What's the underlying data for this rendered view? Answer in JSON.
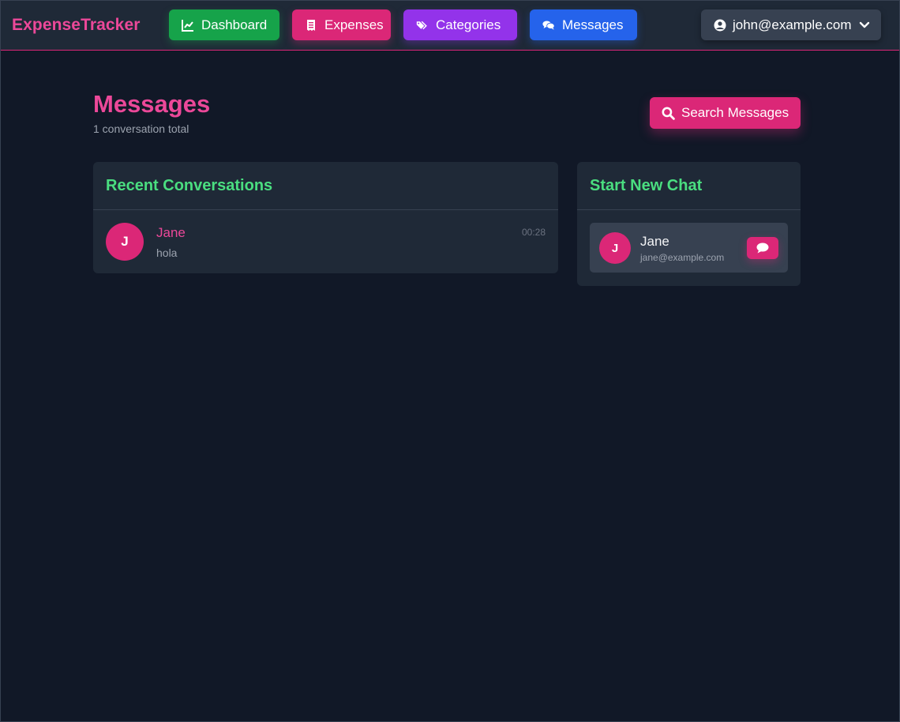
{
  "nav": {
    "brand": "ExpenseTracker",
    "items": [
      {
        "label": "Dashboard",
        "icon": "chart-line-icon",
        "color": "#16a34a"
      },
      {
        "label": "Expenses",
        "icon": "receipt-icon",
        "color": "#db2777"
      },
      {
        "label": "Categories",
        "icon": "tags-icon",
        "color": "#9333ea"
      },
      {
        "label": "Messages",
        "icon": "comments-icon",
        "color": "#2563eb"
      }
    ],
    "user": {
      "email": "john@example.com",
      "icon": "user-circle-icon"
    }
  },
  "header": {
    "title": "Messages",
    "subtitle": "1 conversation total",
    "search_button": "Search Messages"
  },
  "recent": {
    "title": "Recent Conversations",
    "conversations": [
      {
        "initial": "J",
        "name": "Jane",
        "preview": "hola",
        "time": "00:28"
      }
    ]
  },
  "new_chat": {
    "title": "Start New Chat",
    "contacts": [
      {
        "initial": "J",
        "name": "Jane",
        "email": "jane@example.com"
      }
    ]
  },
  "colors": {
    "accent": "#ec4899",
    "heading_green": "#4ade80",
    "background": "#111827",
    "panel": "#1f2937"
  }
}
